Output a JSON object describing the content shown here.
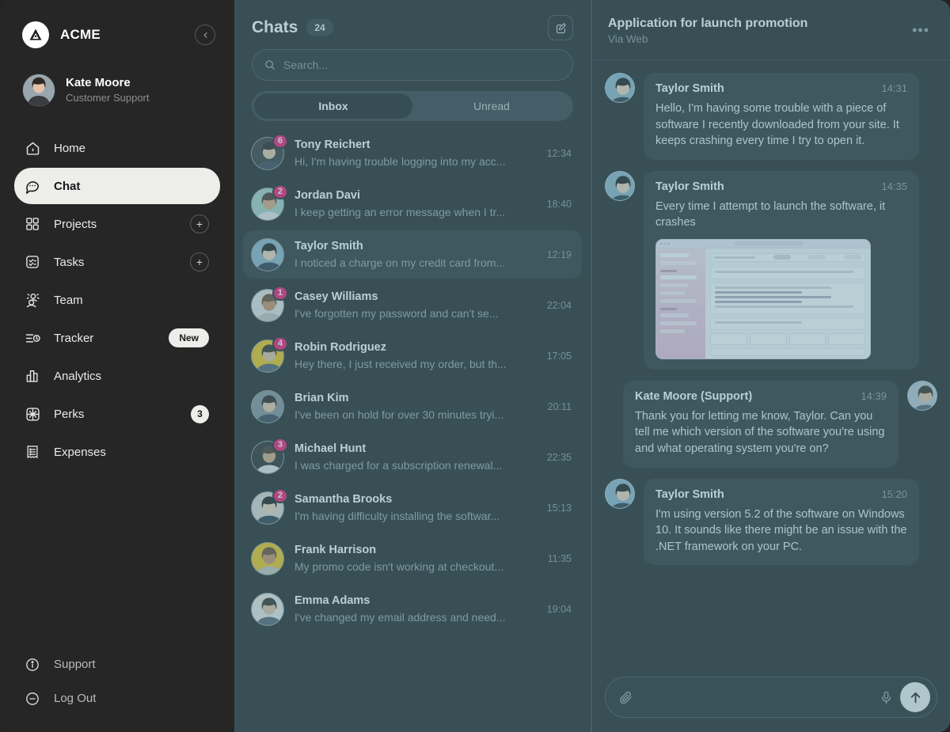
{
  "sidebar": {
    "brand": {
      "name": "ACME",
      "logo_icon": "acme-triangle-logo",
      "collapse_icon": "chevron-left-icon"
    },
    "user": {
      "name": "Kate Moore",
      "role": "Customer Support",
      "avatar_icon": "user-avatar"
    },
    "items": [
      {
        "label": "Home",
        "icon": "home-icon",
        "active": false,
        "accessory": "none"
      },
      {
        "label": "Chat",
        "icon": "chat-bubble-icon",
        "active": true,
        "accessory": "none"
      },
      {
        "label": "Projects",
        "icon": "grid-squares-icon",
        "active": false,
        "accessory": "plus",
        "accessory_label": "+"
      },
      {
        "label": "Tasks",
        "icon": "checklist-icon",
        "active": false,
        "accessory": "plus",
        "accessory_label": "+"
      },
      {
        "label": "Team",
        "icon": "people-icon",
        "active": false,
        "accessory": "none"
      },
      {
        "label": "Tracker",
        "icon": "tracker-clock-icon",
        "active": false,
        "accessory": "pill",
        "accessory_label": "New"
      },
      {
        "label": "Analytics",
        "icon": "bar-chart-icon",
        "active": false,
        "accessory": "none"
      },
      {
        "label": "Perks",
        "icon": "gift-icon",
        "active": false,
        "accessory": "count",
        "accessory_label": "3"
      },
      {
        "label": "Expenses",
        "icon": "receipt-icon",
        "active": false,
        "accessory": "none"
      }
    ],
    "bottom_items": [
      {
        "label": "Support",
        "icon": "info-circle-icon"
      },
      {
        "label": "Log Out",
        "icon": "minus-circle-icon"
      }
    ]
  },
  "chatlist": {
    "title": "Chats",
    "count": "24",
    "compose_icon": "compose-pencil-icon",
    "search": {
      "placeholder": "Search...",
      "value": "",
      "icon": "search-icon"
    },
    "tabs": [
      {
        "label": "Inbox",
        "active": true
      },
      {
        "label": "Unread",
        "active": false
      }
    ],
    "items": [
      {
        "name": "Tony Reichert",
        "preview": "Hi, I'm having trouble logging into my acc...",
        "time": "12:34",
        "unread": "6",
        "selected": false,
        "avatar_bg": "#3a3a3a"
      },
      {
        "name": "Jordan Davi",
        "preview": "I keep getting an error message when I tr...",
        "time": "18:40",
        "unread": "2",
        "selected": false,
        "avatar_bg": "#a9cec2"
      },
      {
        "name": "Taylor Smith",
        "preview": "I noticed a charge on my credit card from...",
        "time": "12:19",
        "unread": "",
        "selected": true,
        "avatar_bg": "#8fb4c4"
      },
      {
        "name": "Casey Williams",
        "preview": "I've forgotten my password and can't se...",
        "time": "22:04",
        "unread": "1",
        "selected": false,
        "avatar_bg": "#e6e2de"
      },
      {
        "name": "Robin Rodriguez",
        "preview": "Hey there, I just received my order, but th...",
        "time": "17:05",
        "unread": "4",
        "selected": false,
        "avatar_bg": "#f0c419"
      },
      {
        "name": "Brian Kim",
        "preview": "I've been on hold for over 30 minutes tryi...",
        "time": "20:11",
        "unread": "",
        "selected": false,
        "avatar_bg": "#8a8f95"
      },
      {
        "name": "Michael Hunt",
        "preview": "I was charged for a subscription renewal...",
        "time": "22:35",
        "unread": "3",
        "selected": false,
        "avatar_bg": "#2b2b2b"
      },
      {
        "name": "Samantha Brooks",
        "preview": "I'm having difficulty installing the softwar...",
        "time": "15:13",
        "unread": "2",
        "selected": false,
        "avatar_bg": "#ded5cd"
      },
      {
        "name": "Frank Harrison",
        "preview": "My promo code isn't working at checkout...",
        "time": "11:35",
        "unread": "",
        "selected": false,
        "avatar_bg": "#f0c419"
      },
      {
        "name": "Emma Adams",
        "preview": "I've changed my email address and need...",
        "time": "19:04",
        "unread": "",
        "selected": false,
        "avatar_bg": "#ece7e2"
      }
    ]
  },
  "conversation": {
    "title": "Application for launch promotion",
    "subtitle": "Via Web",
    "menu_icon": "more-horizontal-icon",
    "messages": [
      {
        "author": "Taylor Smith",
        "time": "14:31",
        "body": "Hello, I'm having some trouble with a piece of software I recently downloaded from your site. It keeps crashing every time I try to open it.",
        "outgoing": false,
        "attachment": "none"
      },
      {
        "author": "Taylor Smith",
        "time": "14:35",
        "body": "Every time I attempt to launch the software, it crashes",
        "outgoing": false,
        "attachment": "app-screenshot"
      },
      {
        "author": "Kate Moore (Support)",
        "time": "14:39",
        "body": "Thank you for letting me know, Taylor. Can you tell me which version of the software you're using and what operating system you're on?",
        "outgoing": true,
        "attachment": "none"
      },
      {
        "author": "Taylor Smith",
        "time": "15:20",
        "body": "I'm using version 5.2 of the software on Windows 10. It sounds like there might be an issue with the .NET framework on your PC.",
        "outgoing": false,
        "attachment": "none"
      }
    ],
    "composer": {
      "placeholder": "",
      "value": "",
      "attach_icon": "paperclip-icon",
      "mic_icon": "microphone-icon",
      "send_icon": "arrow-up-icon"
    }
  },
  "colors": {
    "app_bg": "#242424",
    "sidebar_bg": "#262626",
    "accent_badge": "#f5156c",
    "active_nav": "#ededea",
    "selection_tint": "#568d9e",
    "bubble_bg": "#2f3133"
  }
}
